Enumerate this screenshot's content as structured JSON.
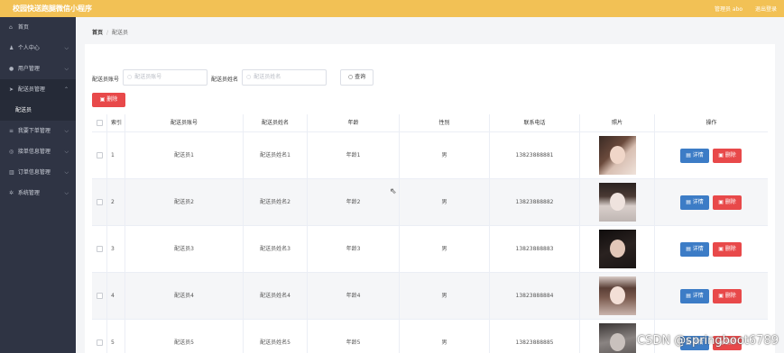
{
  "header": {
    "title": "校园快送跑腿微信小程序",
    "user_label": "管理员 abo",
    "logout_label": "退出登录"
  },
  "sidebar": {
    "items": [
      {
        "label": "首页",
        "icon": "home-icon",
        "glyph": "⌂",
        "chevron": ""
      },
      {
        "label": "个人中心",
        "icon": "person-icon",
        "glyph": "♟",
        "chevron": "⌵"
      },
      {
        "label": "用户管理",
        "icon": "location-icon",
        "glyph": "●",
        "chevron": "⌵"
      },
      {
        "label": "配送员管理",
        "icon": "send-icon",
        "glyph": "➤",
        "chevron": "⌵",
        "active": true
      },
      {
        "label": "我要下单管理",
        "icon": "list-icon",
        "glyph": "≡",
        "chevron": "⌵"
      },
      {
        "label": "接单信息管理",
        "icon": "circle-icon",
        "glyph": "◎",
        "chevron": "⌵"
      },
      {
        "label": "订单信息管理",
        "icon": "chart-icon",
        "glyph": "▥",
        "chevron": "⌵"
      },
      {
        "label": "系统管理",
        "icon": "settings-icon",
        "glyph": "✲",
        "chevron": "⌵"
      }
    ],
    "active_sub": "配送员"
  },
  "breadcrumb": {
    "home": "首页",
    "separator": "/",
    "current": "配送员"
  },
  "search": {
    "account_label": "配送员账号",
    "account_placeholder": "配送员账号",
    "name_label": "配送员姓名",
    "name_placeholder": "配送员姓名",
    "query_label": "查询"
  },
  "actions": {
    "delete_label": "删除"
  },
  "table": {
    "headers": {
      "index": "索引",
      "account": "配送员账号",
      "name": "配送员姓名",
      "age": "年龄",
      "gender": "性别",
      "phone": "联系电话",
      "photo": "照片",
      "operation": "操作"
    },
    "rows": [
      {
        "index": "1",
        "account": "配送员1",
        "name": "配送员姓名1",
        "age": "年龄1",
        "gender": "男",
        "phone": "13823888881",
        "detail": "详情",
        "delete": "删除"
      },
      {
        "index": "2",
        "account": "配送员2",
        "name": "配送员姓名2",
        "age": "年龄2",
        "gender": "男",
        "phone": "13823888882",
        "detail": "详情",
        "delete": "删除"
      },
      {
        "index": "3",
        "account": "配送员3",
        "name": "配送员姓名3",
        "age": "年龄3",
        "gender": "男",
        "phone": "13823888883",
        "detail": "详情",
        "delete": "删除"
      },
      {
        "index": "4",
        "account": "配送员4",
        "name": "配送员姓名4",
        "age": "年龄4",
        "gender": "男",
        "phone": "13823888884",
        "detail": "详情",
        "delete": "删除"
      },
      {
        "index": "5",
        "account": "配送员5",
        "name": "配送员姓名5",
        "age": "年龄5",
        "gender": "男",
        "phone": "13823888885",
        "detail": "详情",
        "delete": "删除"
      }
    ]
  },
  "watermark": "CSDN @springboot6789",
  "colors": {
    "topbar": "#f2c155",
    "sidebar": "#2f3444",
    "primary": "#3c7cc6",
    "danger": "#e8494a"
  }
}
